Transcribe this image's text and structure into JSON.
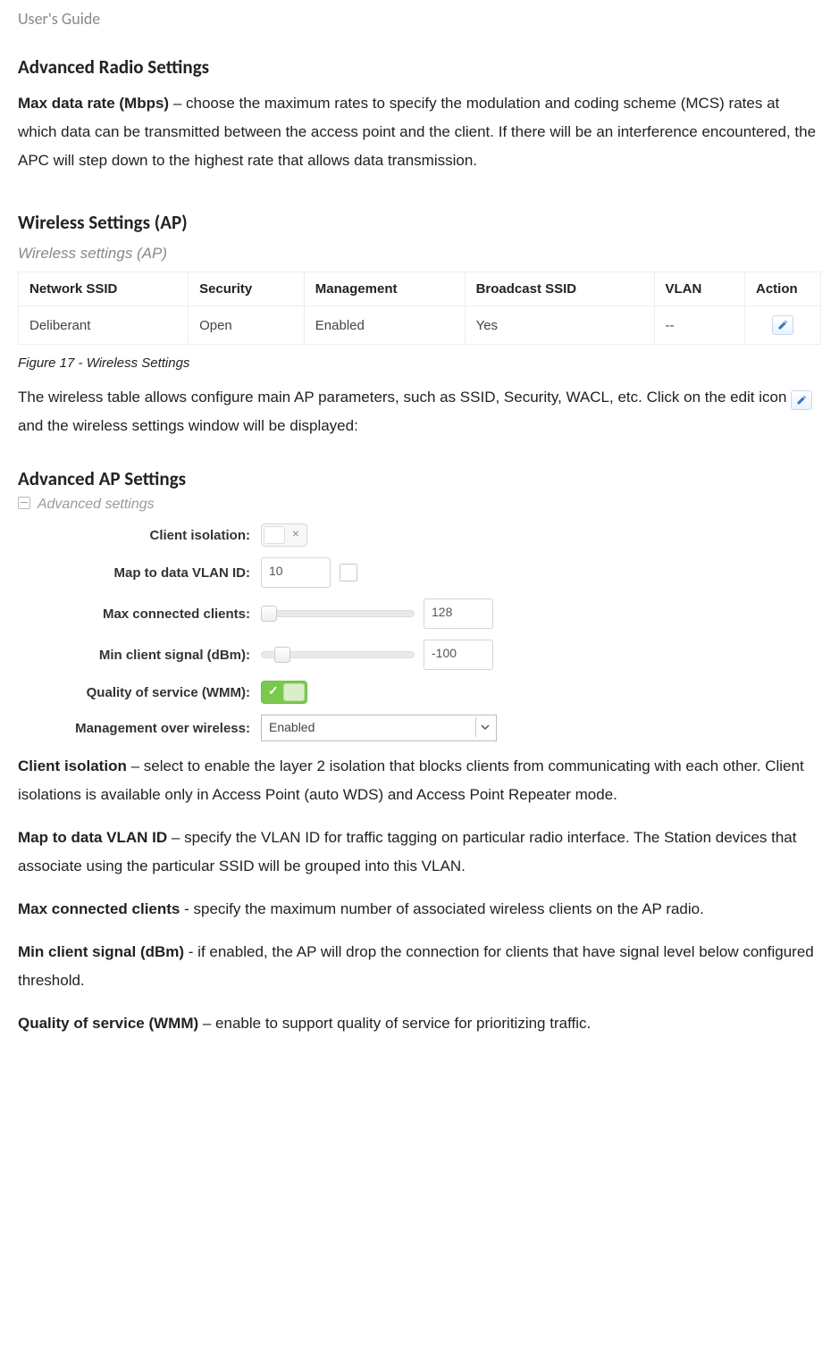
{
  "header": {
    "doc_label": "User's Guide"
  },
  "s1": {
    "title": "Advanced Radio Settings",
    "p1_b": "Max data rate (Mbps)",
    "p1": " – choose the maximum rates to specify the modulation and coding scheme (MCS) rates at which data can be transmitted between the access point and the client. If there will be an interference encountered, the APC will step down to the highest rate that allows data transmission."
  },
  "s2": {
    "title": "Wireless Settings (AP)",
    "panel_label": "Wireless settings (AP)",
    "table": {
      "headers": [
        "Network SSID",
        "Security",
        "Management",
        "Broadcast SSID",
        "VLAN",
        "Action"
      ],
      "row": {
        "ssid": "Deliberant",
        "security": "Open",
        "management": "Enabled",
        "broadcast": "Yes",
        "vlan": "--"
      }
    },
    "caption": "Figure 17 - Wireless Settings",
    "intro_a": "The wireless table allows configure main AP parameters, such as SSID, Security, WACL, etc. Click on the edit icon ",
    "intro_b": "and the wireless settings window will be displayed:"
  },
  "s3": {
    "title": "Advanced AP Settings",
    "panel_label": "Advanced settings",
    "labels": {
      "client_isolation": "Client isolation:",
      "vlan": "Map to data VLAN ID:",
      "max_clients": "Max connected clients:",
      "min_signal": "Min client signal (dBm):",
      "qos": "Quality of service (WMM):",
      "mgmt": "Management over wireless:"
    },
    "values": {
      "vlan": "10",
      "max_clients": "128",
      "min_signal": "-100",
      "mgmt": "Enabled"
    }
  },
  "defs": {
    "ci_b": "Client isolation",
    "ci": " – select to enable the layer 2 isolation that blocks clients from communicating with each other. Client isolations is available only in Access Point (auto WDS) and Access Point Repeater mode.",
    "vlan_b": "Map to data VLAN ID",
    "vlan": " – specify the VLAN ID for traffic tagging on particular radio interface. The Station devices that associate using the particular SSID will be grouped into this VLAN.",
    "max_b": "Max connected clients",
    "max": " - specify the maximum number of associated wireless clients on the AP radio.",
    "min_b": "Min client signal (dBm)",
    "min": " - if enabled, the AP will drop the connection for clients that have signal level below configured threshold.",
    "qos_b": "Quality of service (WMM)",
    "qos": " – enable to support quality of service for prioritizing traffic."
  },
  "chart_data": {
    "type": "table",
    "headers": [
      "Network SSID",
      "Security",
      "Management",
      "Broadcast SSID",
      "VLAN",
      "Action"
    ],
    "rows": [
      [
        "Deliberant",
        "Open",
        "Enabled",
        "Yes",
        "--",
        "edit"
      ]
    ]
  }
}
